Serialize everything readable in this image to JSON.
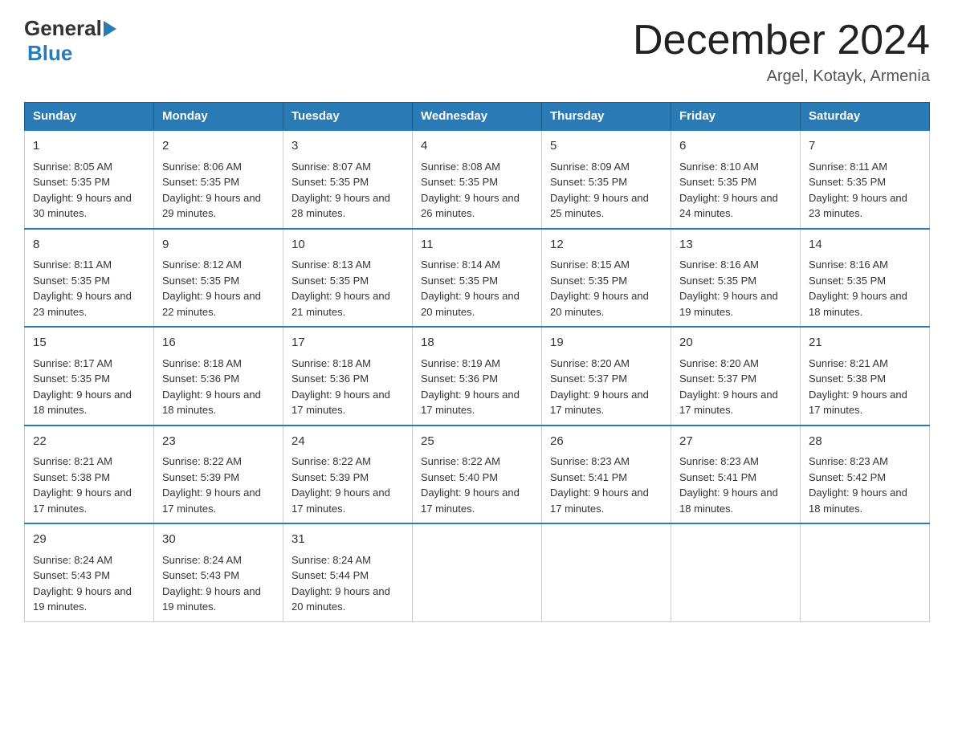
{
  "logo": {
    "general": "General",
    "blue": "Blue"
  },
  "header": {
    "title": "December 2024",
    "subtitle": "Argel, Kotayk, Armenia"
  },
  "calendar": {
    "days": [
      "Sunday",
      "Monday",
      "Tuesday",
      "Wednesday",
      "Thursday",
      "Friday",
      "Saturday"
    ],
    "weeks": [
      [
        {
          "day": "1",
          "sunrise": "8:05 AM",
          "sunset": "5:35 PM",
          "daylight": "9 hours and 30 minutes."
        },
        {
          "day": "2",
          "sunrise": "8:06 AM",
          "sunset": "5:35 PM",
          "daylight": "9 hours and 29 minutes."
        },
        {
          "day": "3",
          "sunrise": "8:07 AM",
          "sunset": "5:35 PM",
          "daylight": "9 hours and 28 minutes."
        },
        {
          "day": "4",
          "sunrise": "8:08 AM",
          "sunset": "5:35 PM",
          "daylight": "9 hours and 26 minutes."
        },
        {
          "day": "5",
          "sunrise": "8:09 AM",
          "sunset": "5:35 PM",
          "daylight": "9 hours and 25 minutes."
        },
        {
          "day": "6",
          "sunrise": "8:10 AM",
          "sunset": "5:35 PM",
          "daylight": "9 hours and 24 minutes."
        },
        {
          "day": "7",
          "sunrise": "8:11 AM",
          "sunset": "5:35 PM",
          "daylight": "9 hours and 23 minutes."
        }
      ],
      [
        {
          "day": "8",
          "sunrise": "8:11 AM",
          "sunset": "5:35 PM",
          "daylight": "9 hours and 23 minutes."
        },
        {
          "day": "9",
          "sunrise": "8:12 AM",
          "sunset": "5:35 PM",
          "daylight": "9 hours and 22 minutes."
        },
        {
          "day": "10",
          "sunrise": "8:13 AM",
          "sunset": "5:35 PM",
          "daylight": "9 hours and 21 minutes."
        },
        {
          "day": "11",
          "sunrise": "8:14 AM",
          "sunset": "5:35 PM",
          "daylight": "9 hours and 20 minutes."
        },
        {
          "day": "12",
          "sunrise": "8:15 AM",
          "sunset": "5:35 PM",
          "daylight": "9 hours and 20 minutes."
        },
        {
          "day": "13",
          "sunrise": "8:16 AM",
          "sunset": "5:35 PM",
          "daylight": "9 hours and 19 minutes."
        },
        {
          "day": "14",
          "sunrise": "8:16 AM",
          "sunset": "5:35 PM",
          "daylight": "9 hours and 18 minutes."
        }
      ],
      [
        {
          "day": "15",
          "sunrise": "8:17 AM",
          "sunset": "5:35 PM",
          "daylight": "9 hours and 18 minutes."
        },
        {
          "day": "16",
          "sunrise": "8:18 AM",
          "sunset": "5:36 PM",
          "daylight": "9 hours and 18 minutes."
        },
        {
          "day": "17",
          "sunrise": "8:18 AM",
          "sunset": "5:36 PM",
          "daylight": "9 hours and 17 minutes."
        },
        {
          "day": "18",
          "sunrise": "8:19 AM",
          "sunset": "5:36 PM",
          "daylight": "9 hours and 17 minutes."
        },
        {
          "day": "19",
          "sunrise": "8:20 AM",
          "sunset": "5:37 PM",
          "daylight": "9 hours and 17 minutes."
        },
        {
          "day": "20",
          "sunrise": "8:20 AM",
          "sunset": "5:37 PM",
          "daylight": "9 hours and 17 minutes."
        },
        {
          "day": "21",
          "sunrise": "8:21 AM",
          "sunset": "5:38 PM",
          "daylight": "9 hours and 17 minutes."
        }
      ],
      [
        {
          "day": "22",
          "sunrise": "8:21 AM",
          "sunset": "5:38 PM",
          "daylight": "9 hours and 17 minutes."
        },
        {
          "day": "23",
          "sunrise": "8:22 AM",
          "sunset": "5:39 PM",
          "daylight": "9 hours and 17 minutes."
        },
        {
          "day": "24",
          "sunrise": "8:22 AM",
          "sunset": "5:39 PM",
          "daylight": "9 hours and 17 minutes."
        },
        {
          "day": "25",
          "sunrise": "8:22 AM",
          "sunset": "5:40 PM",
          "daylight": "9 hours and 17 minutes."
        },
        {
          "day": "26",
          "sunrise": "8:23 AM",
          "sunset": "5:41 PM",
          "daylight": "9 hours and 17 minutes."
        },
        {
          "day": "27",
          "sunrise": "8:23 AM",
          "sunset": "5:41 PM",
          "daylight": "9 hours and 18 minutes."
        },
        {
          "day": "28",
          "sunrise": "8:23 AM",
          "sunset": "5:42 PM",
          "daylight": "9 hours and 18 minutes."
        }
      ],
      [
        {
          "day": "29",
          "sunrise": "8:24 AM",
          "sunset": "5:43 PM",
          "daylight": "9 hours and 19 minutes."
        },
        {
          "day": "30",
          "sunrise": "8:24 AM",
          "sunset": "5:43 PM",
          "daylight": "9 hours and 19 minutes."
        },
        {
          "day": "31",
          "sunrise": "8:24 AM",
          "sunset": "5:44 PM",
          "daylight": "9 hours and 20 minutes."
        },
        null,
        null,
        null,
        null
      ]
    ]
  }
}
